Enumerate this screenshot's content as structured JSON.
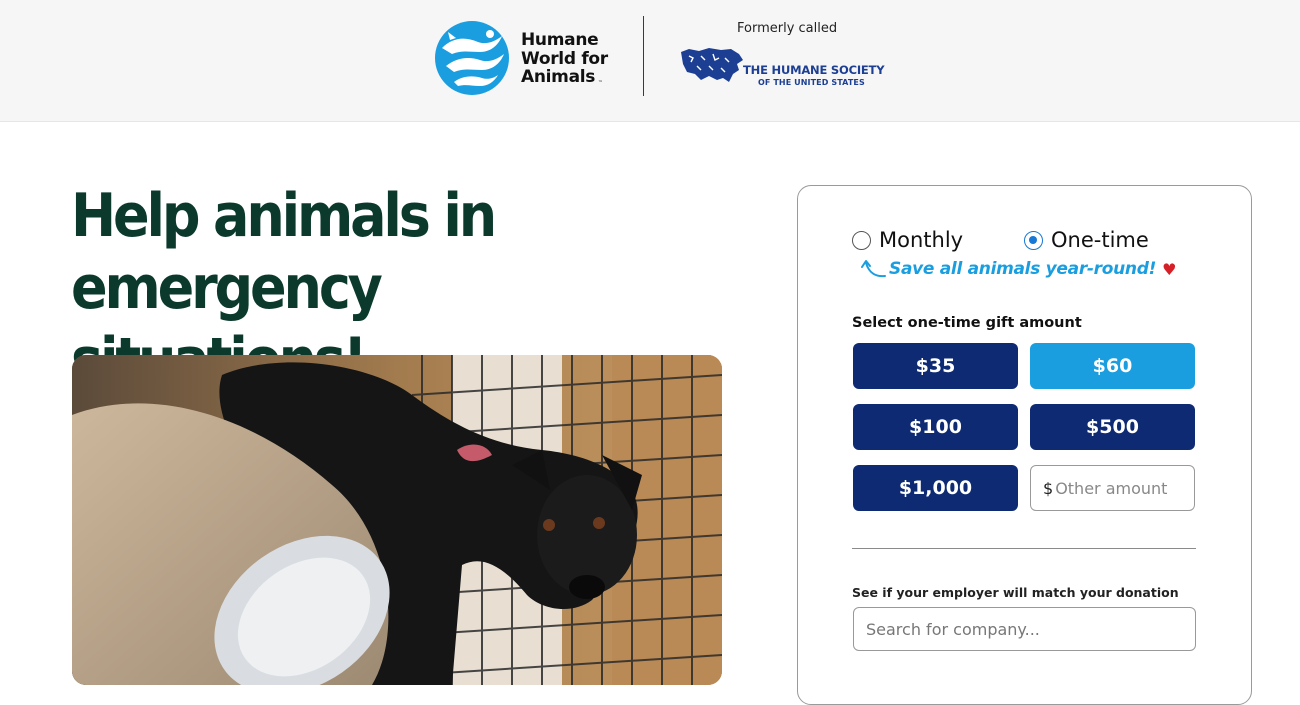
{
  "header": {
    "brand_line1": "Humane",
    "brand_line2": "World for",
    "brand_line3": "Animals",
    "brand_tm": "™",
    "formerly_label": "Formerly called",
    "former_name_line1": "THE HUMANE SOCIETY",
    "former_name_line2": "OF THE UNITED STATES"
  },
  "main": {
    "headline_line1": "Help animals in",
    "headline_line2": "emergency situations!",
    "hero_image_icon": "dog-in-kennel-photo"
  },
  "donation": {
    "frequency_options": [
      {
        "label": "Monthly",
        "checked": false
      },
      {
        "label": "One-time",
        "checked": true
      }
    ],
    "save_note": "Save all animals year-round!",
    "amount_label": "Select one-time gift amount",
    "amounts": [
      {
        "label": "$35",
        "selected": false
      },
      {
        "label": "$60",
        "selected": true
      },
      {
        "label": "$100",
        "selected": false
      },
      {
        "label": "$500",
        "selected": false
      },
      {
        "label": "$1,000",
        "selected": false
      }
    ],
    "other_currency": "$",
    "other_placeholder": "Other amount",
    "employer_label": "See if your employer will match your donation",
    "company_placeholder": "Search for company..."
  },
  "colors": {
    "navy": "#0d2a72",
    "sky": "#1a9ee0",
    "headline_green": "#0b3a2c",
    "heart_red": "#d62027"
  }
}
